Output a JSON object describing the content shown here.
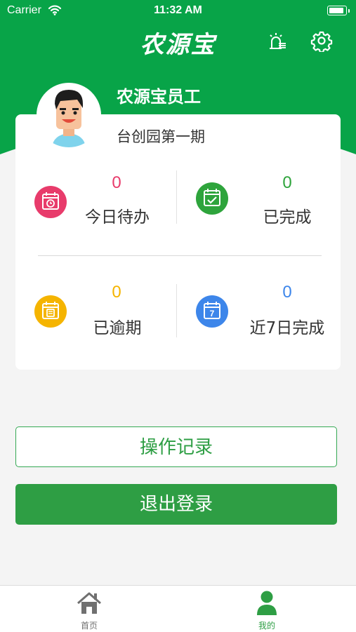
{
  "status_bar": {
    "carrier": "Carrier",
    "time": "11:32 AM"
  },
  "header": {
    "logo": "农源宝",
    "alert_icon": "alarm-icon",
    "settings_icon": "gear-icon"
  },
  "profile": {
    "name": "农源宝员工",
    "organization": "台创园第一期"
  },
  "stats": [
    {
      "label": "今日待办",
      "value": "0",
      "color": "#e83b6b",
      "icon": "calendar-clock-icon"
    },
    {
      "label": "已完成",
      "value": "0",
      "color": "#2ea43c",
      "icon": "calendar-check-icon"
    },
    {
      "label": "已逾期",
      "value": "0",
      "color": "#f5b400",
      "icon": "calendar-overdue-icon"
    },
    {
      "label": "近7日完成",
      "value": "0",
      "color": "#3d86ea",
      "icon": "calendar-7-icon"
    }
  ],
  "actions": {
    "operation_log": "操作记录",
    "logout": "退出登录"
  },
  "tabbar": {
    "home": "首页",
    "mine": "我的",
    "active_color": "#2e9e44",
    "inactive_color": "#707070"
  },
  "theme": {
    "primary": "#00a651"
  }
}
